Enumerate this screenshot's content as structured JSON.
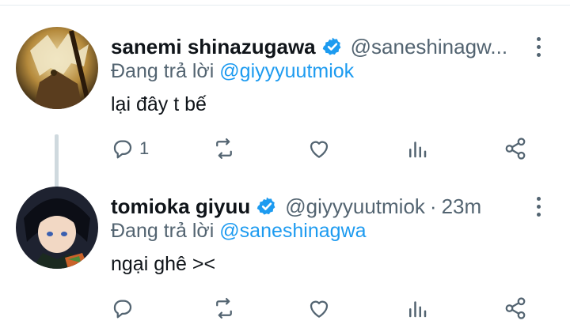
{
  "tweets": [
    {
      "display_name": "sanemi shinazugawa",
      "handle": "@saneshinagw...",
      "time": "",
      "reply_prefix": "Đang trả lời",
      "reply_to": "@giyyyuutmiok",
      "text": "lại đây t bế",
      "reply_count": "1",
      "verified_color": "#1d9bf0"
    },
    {
      "display_name": "tomioka giyuu",
      "handle": "@giyyyuutmiok",
      "time": "23m",
      "dot": "·",
      "reply_prefix": "Đang trả lời",
      "reply_to": "@saneshinagwa",
      "text": "ngại ghê ><",
      "reply_count": "",
      "verified_color": "#1d9bf0"
    }
  ],
  "colors": {
    "accent": "#1d9bf0",
    "secondary_text": "#536471",
    "primary_text": "#0f1419",
    "thread_line": "#cfd9de"
  },
  "icons": [
    "verified-badge-icon",
    "more-icon",
    "reply-icon",
    "retweet-icon",
    "like-icon",
    "stats-icon",
    "share-icon"
  ]
}
